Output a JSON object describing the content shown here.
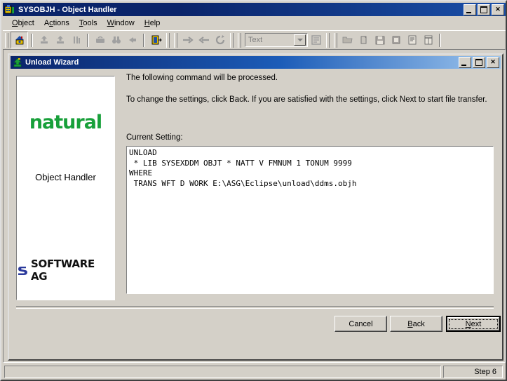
{
  "window": {
    "title": "SYSOBJH - Object Handler",
    "icon": "object-handler-icon",
    "minimize_label": "Minimize",
    "maximize_label": "Maximize",
    "close_label": "Close"
  },
  "menubar": {
    "items": [
      {
        "label": "Object",
        "accel": "O"
      },
      {
        "label": "Actions",
        "accel": "c"
      },
      {
        "label": "Tools",
        "accel": "T"
      },
      {
        "label": "Window",
        "accel": "W"
      },
      {
        "label": "Help",
        "accel": "H"
      }
    ]
  },
  "toolbar": {
    "groups": [
      {
        "buttons": [
          {
            "name": "home-icon",
            "selected": true,
            "enabled": true
          }
        ]
      },
      {
        "buttons": [
          {
            "name": "unload-icon",
            "selected": false,
            "enabled": false
          },
          {
            "name": "load-icon",
            "selected": false,
            "enabled": false
          },
          {
            "name": "admin-tools-icon",
            "selected": false,
            "enabled": false
          }
        ]
      },
      {
        "buttons": [
          {
            "name": "briefcase-icon",
            "selected": false,
            "enabled": false
          },
          {
            "name": "find-binoculars-icon",
            "selected": false,
            "enabled": false
          },
          {
            "name": "delete-icon",
            "selected": false,
            "enabled": false
          }
        ]
      },
      {
        "buttons": [
          {
            "name": "exit-door-icon",
            "selected": false,
            "enabled": true
          }
        ]
      },
      {
        "buttons": [
          {
            "name": "arrow-right-icon",
            "selected": false,
            "enabled": false
          },
          {
            "name": "arrow-left-icon",
            "selected": false,
            "enabled": false
          },
          {
            "name": "refresh-icon",
            "selected": false,
            "enabled": false
          }
        ]
      }
    ],
    "combo": {
      "name": "format-combo",
      "value": "Text",
      "arrow": "chevron-down-icon"
    },
    "after_combo": [
      {
        "name": "profile-icon",
        "enabled": false
      }
    ],
    "file_buttons": [
      {
        "name": "open-folder-icon",
        "enabled": false
      },
      {
        "name": "new-file-icon",
        "enabled": false
      },
      {
        "name": "save-icon",
        "enabled": false
      },
      {
        "name": "save-as-icon",
        "enabled": false
      },
      {
        "name": "report-icon",
        "enabled": false
      },
      {
        "name": "list-report-icon",
        "enabled": false
      }
    ]
  },
  "wizard": {
    "title": "Unload Wizard",
    "icon": "unload-arrow-icon",
    "minimize_label": "Minimize",
    "maximize_label": "Maximize",
    "close_label": "Close",
    "logo_panel": {
      "product_name": "natural",
      "product_color": "#18a03a",
      "subtitle": "Object Handler",
      "vendor": "SOFTWARE AG",
      "vendor_color": "#2b3a9c"
    },
    "lead_line_1": "The following command will be processed.",
    "lead_line_2": "To change the settings, click Back. If you are satisfied with the settings, click Next to start file transfer.",
    "current_setting_label": "Current Setting:",
    "command_text": "UNLOAD\n * LIB SYSEXDDM OBJT * NATT V FMNUM 1 TONUM 9999\nWHERE\n TRANS WFT D WORK E:\\ASG\\Eclipse\\unload\\ddms.objh",
    "buttons": {
      "cancel": "Cancel",
      "back_pre": "",
      "back_accel": "B",
      "back_post": "ack",
      "next_pre": "",
      "next_accel": "N",
      "next_post": "ext",
      "back": "Back",
      "next": "Next"
    }
  },
  "statusbar": {
    "main": "",
    "step": "Step 6"
  },
  "colors": {
    "face": "#d4d0c8",
    "title_active": "#0a246a",
    "natural_green": "#18a03a",
    "sag_blue": "#2b3a9c"
  }
}
